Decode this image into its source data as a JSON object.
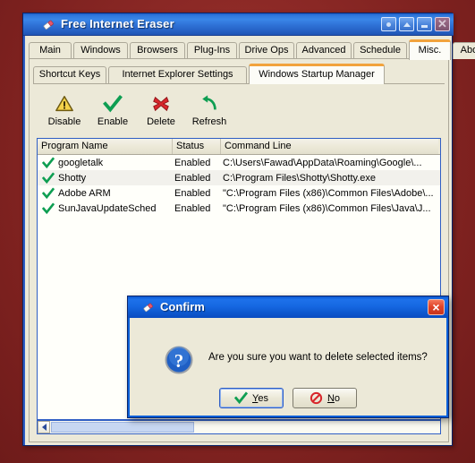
{
  "window": {
    "title": "Free Internet Eraser",
    "icon": "eraser-icon",
    "buttons": [
      {
        "name": "rollup-button",
        "glyph": "dot"
      },
      {
        "name": "restore-up-button",
        "glyph": "up"
      },
      {
        "name": "minimize-button",
        "glyph": "minimize"
      },
      {
        "name": "close-button",
        "glyph": "x"
      }
    ]
  },
  "tabs": {
    "items": [
      {
        "label": "Main",
        "selected": false
      },
      {
        "label": "Windows",
        "selected": false
      },
      {
        "label": "Browsers",
        "selected": false
      },
      {
        "label": "Plug-Ins",
        "selected": false
      },
      {
        "label": "Drive Ops",
        "selected": false
      },
      {
        "label": "Advanced",
        "selected": false
      },
      {
        "label": "Schedule",
        "selected": false
      },
      {
        "label": "Misc.",
        "selected": true
      },
      {
        "label": "About",
        "selected": false
      }
    ],
    "selected_accent": "#f2a33c"
  },
  "subtabs": {
    "items": [
      {
        "label": "Shortcut Keys",
        "selected": false
      },
      {
        "label": "Internet Explorer Settings",
        "selected": false
      },
      {
        "label": "Windows Startup Manager",
        "selected": true
      }
    ]
  },
  "toolbar": {
    "items": [
      {
        "label": "Disable",
        "icon": "warning-triangle-icon"
      },
      {
        "label": "Enable",
        "icon": "green-check-icon"
      },
      {
        "label": "Delete",
        "icon": "red-x-icon"
      },
      {
        "label": "Refresh",
        "icon": "refresh-arrow-icon"
      }
    ]
  },
  "listview": {
    "columns": [
      "Program Name",
      "Status",
      "Command Line"
    ],
    "rows": [
      {
        "icon": "green-check-icon",
        "name": "googletalk",
        "status": "Enabled",
        "command": "C:\\Users\\Fawad\\AppData\\Roaming\\Google\\...",
        "highlighted": false
      },
      {
        "icon": "green-check-icon",
        "name": "Shotty",
        "status": "Enabled",
        "command": "C:\\Program Files\\Shotty\\Shotty.exe",
        "highlighted": true
      },
      {
        "icon": "green-check-icon",
        "name": "Adobe ARM",
        "status": "Enabled",
        "command": "\"C:\\Program Files (x86)\\Common Files\\Adobe\\...",
        "highlighted": false
      },
      {
        "icon": "green-check-icon",
        "name": "SunJavaUpdateSched",
        "status": "Enabled",
        "command": "\"C:\\Program Files (x86)\\Common Files\\Java\\J...",
        "highlighted": false
      }
    ]
  },
  "scrollbar": {
    "left_arrow": "scroll-left-icon"
  },
  "dialog": {
    "title": "Confirm",
    "icon": "eraser-icon",
    "close_glyph": "×",
    "message_icon": "question-mark-icon",
    "message": "Are you sure you want to delete selected items?",
    "buttons": [
      {
        "label": "Yes",
        "mnemonic": "Y",
        "rest": "es",
        "icon": "green-check-icon",
        "default": true
      },
      {
        "label": "No",
        "mnemonic": "N",
        "rest": "o",
        "icon": "no-entry-icon",
        "default": false
      }
    ]
  },
  "colors": {
    "desktop": "#8e2a27",
    "window_face": "#ece9d8",
    "titlebar_blue": "#2f78dd",
    "accent_orange": "#f2a33c",
    "list_border": "#2f5ec4"
  }
}
